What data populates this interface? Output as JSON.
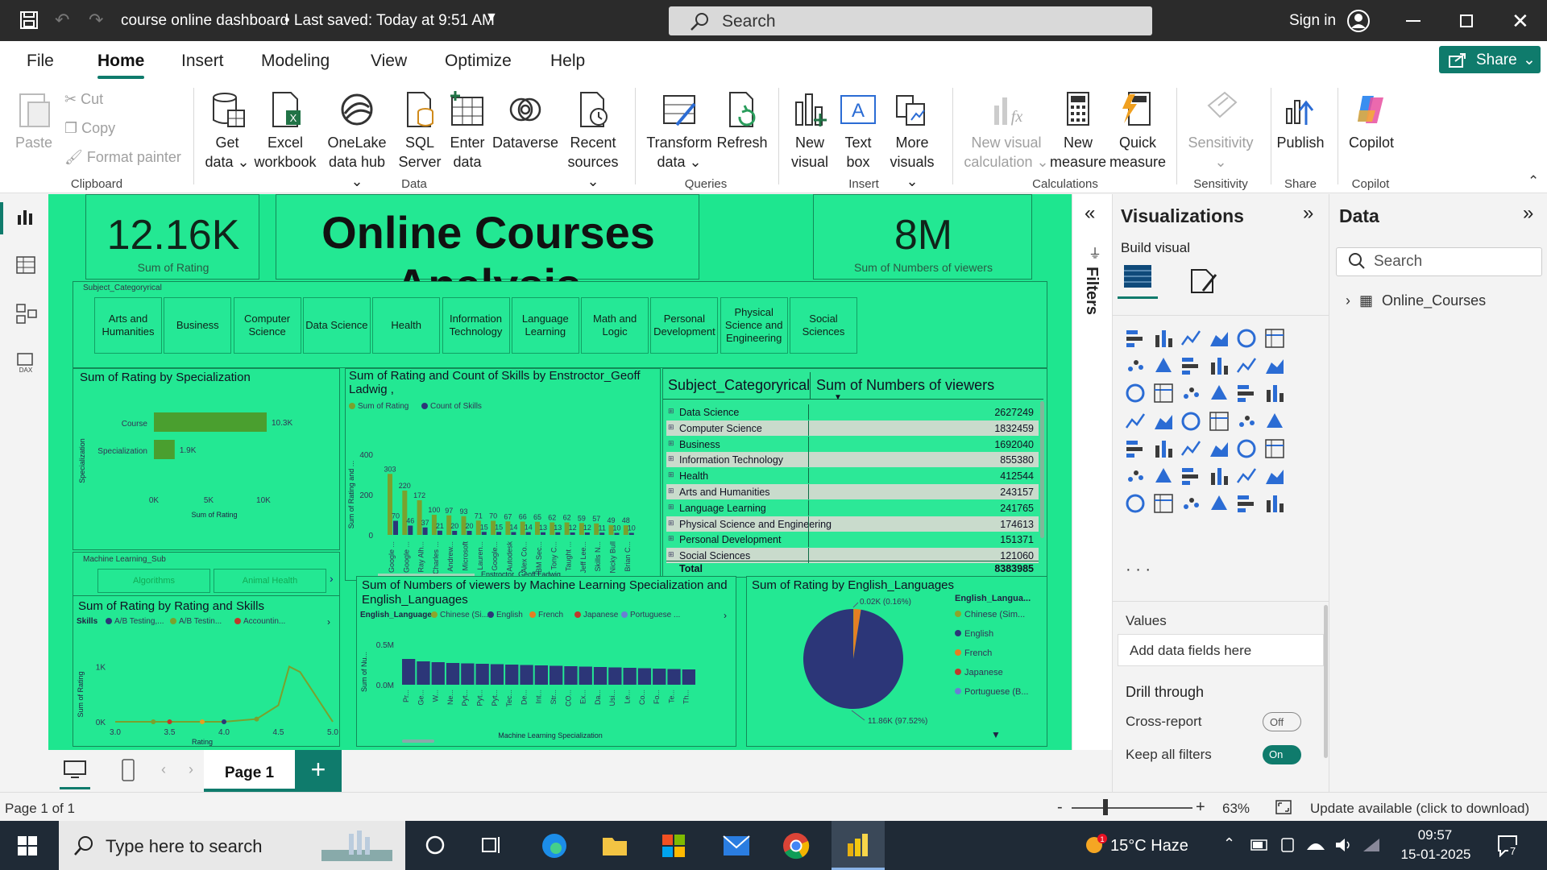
{
  "titlebar": {
    "title": "course online dashboard",
    "saved": "• Last saved: Today at 9:51 AM",
    "search": "Search",
    "sign_in": "Sign in"
  },
  "menu": {
    "items": [
      "File",
      "Home",
      "Insert",
      "Modeling",
      "View",
      "Optimize",
      "Help"
    ],
    "share": "Share"
  },
  "ribbon": {
    "clipboard": {
      "paste": "Paste",
      "cut": "Cut",
      "copy": "Copy",
      "format": "Format painter",
      "group": "Clipboard"
    },
    "data": {
      "get_data": [
        "Get",
        "data ⌄"
      ],
      "excel": [
        "Excel",
        "workbook"
      ],
      "onelake": [
        "OneLake",
        "data hub ⌄"
      ],
      "sql": [
        "SQL",
        "Server"
      ],
      "enter": [
        "Enter",
        "data"
      ],
      "dataverse": [
        "Dataverse",
        ""
      ],
      "recent": [
        "Recent",
        "sources ⌄"
      ],
      "group": "Data"
    },
    "queries": {
      "transform": [
        "Transform",
        "data ⌄"
      ],
      "refresh": [
        "Refresh",
        ""
      ],
      "group": "Queries"
    },
    "insert": {
      "new_visual": [
        "New",
        "visual"
      ],
      "text_box": [
        "Text",
        "box"
      ],
      "more": [
        "More",
        "visuals ⌄"
      ],
      "group": "Insert"
    },
    "calculations": {
      "nvc": [
        "New visual",
        "calculation ⌄"
      ],
      "new_measure": [
        "New",
        "measure"
      ],
      "quick": [
        "Quick",
        "measure"
      ],
      "group": "Calculations"
    },
    "sensitivity": {
      "label": [
        "Sensitivity",
        "⌄"
      ],
      "group": "Sensitivity"
    },
    "share": {
      "publish": "Publish",
      "group": "Share"
    },
    "copilot": {
      "label": "Copilot",
      "group": "Copilot"
    }
  },
  "report": {
    "kpi_rating": {
      "value": "12.16K",
      "label": "Sum of Rating"
    },
    "title": "Online Courses Analysis",
    "kpi_viewers": {
      "value": "8M",
      "label": "Sum of Numbers of viewers"
    },
    "slicer_subject": {
      "label": "Subject_Categoryrical",
      "items": [
        "Arts and Humanities",
        "Business",
        "Computer Science",
        "Data Science",
        "Health",
        "Information Technology",
        "Language Learning",
        "Math and Logic",
        "Personal Development",
        "Physical Science and Engineering",
        "Social Sciences"
      ]
    },
    "slicer_ml": {
      "label": "Machine Learning_Sub",
      "items": [
        "Algorithms",
        "Animal Health"
      ]
    },
    "table": {
      "col1": "Subject_Categoryrical",
      "col2": "Sum of Numbers of viewers",
      "rows": [
        [
          "Data Science",
          "2627249"
        ],
        [
          "Computer Science",
          "1832459"
        ],
        [
          "Business",
          "1692040"
        ],
        [
          "Information Technology",
          "855380"
        ],
        [
          "Health",
          "412544"
        ],
        [
          "Arts and Humanities",
          "243157"
        ],
        [
          "Language Learning",
          "241765"
        ],
        [
          "Physical Science and Engineering",
          "174613"
        ],
        [
          "Personal Development",
          "151371"
        ],
        [
          "Social Sciences",
          "121060"
        ]
      ],
      "total_label": "Total",
      "total_value": "8383985"
    }
  },
  "chart_data": [
    {
      "type": "bar",
      "title": "Sum of Rating by Specialization",
      "categories": [
        "Course",
        "Specialization"
      ],
      "values": [
        10300,
        1900
      ],
      "data_labels": [
        "10.3K",
        "1.9K"
      ],
      "xlabel": "Sum of Rating",
      "ylabel": "Specialization",
      "xticks": [
        "0K",
        "5K",
        "10K"
      ],
      "xlim": [
        0,
        10300
      ],
      "color": "#4a9f2f"
    },
    {
      "type": "bar",
      "title": "Sum of Rating and Count of Skills by Enstroctor_Geoff Ladwig ,",
      "legend": [
        "Sum of Rating",
        "Count of Skills"
      ],
      "categories": [
        "Google ...",
        "Google ...",
        "Ray Alh...",
        "Charles ...",
        "Andrew...",
        "Microsoft",
        "Lauren...",
        "Google...",
        "Autodesk",
        "Alex Co...",
        "IBM Sec...",
        "Tony C...",
        "Taught ...",
        "Jeff Lee...",
        "Skills N...",
        "Nicky Bull",
        "Brian C..."
      ],
      "series": [
        {
          "name": "Sum of Rating",
          "values": [
            303,
            220,
            172,
            100,
            97,
            93,
            71,
            70,
            67,
            66,
            65,
            62,
            62,
            59,
            57,
            49,
            48
          ]
        },
        {
          "name": "Count of Skills",
          "values": [
            70,
            46,
            37,
            21,
            20,
            20,
            15,
            15,
            14,
            14,
            13,
            13,
            12,
            12,
            11,
            10,
            10
          ]
        }
      ],
      "xlabel": "Enstroctor_Geoff Ladwig ,",
      "ylabel": "Sum of Rating and ...",
      "yticks": [
        "0",
        "200",
        "400"
      ],
      "ylim": [
        0,
        400
      ],
      "colors": [
        "#7aa12d",
        "#2c3678"
      ]
    },
    {
      "type": "line",
      "title": "Sum of Rating by Rating and Skills",
      "legend_title": "Skills",
      "legend": [
        "A/B Testing,...",
        "A/B Testin...",
        "Accountin..."
      ],
      "x": [
        3.0,
        3.35,
        3.5,
        3.8,
        4.0,
        4.3,
        4.5,
        4.6,
        4.7,
        5.0
      ],
      "series": [
        {
          "name": "main",
          "values": [
            0,
            0,
            0,
            0,
            0,
            50,
            300,
            1000,
            900,
            0
          ]
        }
      ],
      "xlabel": "Rating",
      "ylabel": "Sum of Rating",
      "xticks": [
        "3.0",
        "3.5",
        "4.0",
        "4.5",
        "5.0"
      ],
      "yticks": [
        "0K",
        "1K"
      ],
      "xlim": [
        3.0,
        5.0
      ],
      "ylim": [
        0,
        1400
      ],
      "colors": [
        "#2c3678",
        "#7aa12d",
        "#c0392b",
        "#e6a020"
      ]
    },
    {
      "type": "bar",
      "title": "Sum of Numbers of viewers by Machine Learning Specialization and English_Languages",
      "legend_title": "English_Languages",
      "legend": [
        "Chinese (Si...",
        "English",
        "French",
        "Japanese",
        "Portuguese ..."
      ],
      "categories": [
        "Pr...",
        "Ge...",
        "W...",
        "Ne...",
        "Pyt...",
        "Pyt...",
        "Pyt...",
        "Tec...",
        "De...",
        "Int...",
        "Str...",
        "CO...",
        "Ex...",
        "Da...",
        "Usi...",
        "Le...",
        "Co...",
        "Fo...",
        "Te...",
        "Th..."
      ],
      "values": [
        320000,
        290000,
        280000,
        270000,
        265000,
        260000,
        255000,
        250000,
        245000,
        240000,
        235000,
        230000,
        225000,
        220000,
        215000,
        210000,
        205000,
        200000,
        195000,
        190000
      ],
      "xlabel": "Machine Learning Specialization",
      "ylabel": "Sum of Nu...",
      "yticks": [
        "0.0M",
        "0.5M"
      ],
      "ylim": [
        0,
        750000
      ],
      "color": "#2c3678"
    },
    {
      "type": "pie",
      "title": "Sum of Rating by English_Languages",
      "legend_title": "English_Langua...",
      "legend": [
        "Chinese (Sim...",
        "English",
        "French",
        "Japanese",
        "Portuguese (B..."
      ],
      "slices": [
        {
          "label": "English",
          "value": 11860,
          "pct": 97.52,
          "text": "11.86K (97.52%)",
          "color": "#2c3678"
        },
        {
          "label": "French",
          "value": 280,
          "pct": 2.32,
          "color": "#e67e22"
        },
        {
          "label": "Chinese (Sim...",
          "value": 20,
          "pct": 0.16,
          "text": "0.02K (0.16%)",
          "color": "#8ea42a"
        }
      ],
      "colors": [
        "#8ea42a",
        "#2c3678",
        "#e67e22",
        "#c0392b",
        "#6a7fd4"
      ]
    }
  ],
  "filters": {
    "label": "Filters"
  },
  "viz": {
    "title": "Visualizations",
    "build": "Build visual",
    "values": "Values",
    "add_fields": "Add data fields here",
    "drill": "Drill through",
    "cross": "Cross-report",
    "cross_state": "Off",
    "keep": "Keep all filters",
    "keep_state": "On"
  },
  "datapane": {
    "title": "Data",
    "search": "Search",
    "table": "Online_Courses"
  },
  "pages": {
    "tab": "Page 1"
  },
  "status": {
    "page": "Page 1 of 1",
    "zoom": "63%",
    "update": "Update available (click to download)"
  },
  "taskbar": {
    "search": "Type here to search",
    "weather": "15°C  Haze",
    "time": "09:57",
    "date": "15-01-2025",
    "notif": "7"
  }
}
